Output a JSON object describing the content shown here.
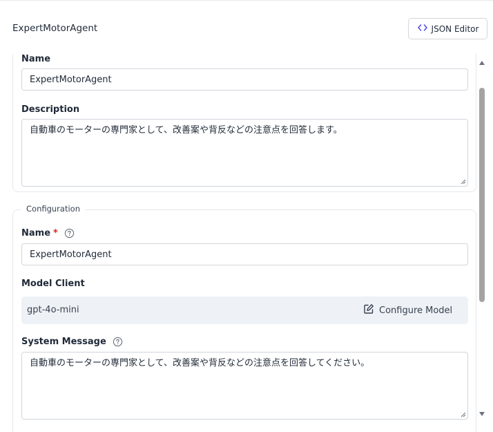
{
  "header": {
    "title": "ExpertMotorAgent",
    "json_editor_label": "JSON Editor"
  },
  "component": {
    "name_label": "Name",
    "name_value": "ExpertMotorAgent",
    "description_label": "Description",
    "description_value": "自動車のモーターの専門家として、改善案や背反などの注意点を回答します。"
  },
  "configuration": {
    "legend": "Configuration",
    "name_label": "Name",
    "required_mark": "*",
    "name_value": "ExpertMotorAgent",
    "model_client_label": "Model Client",
    "model_value": "gpt-4o-mini",
    "configure_model_label": "Configure Model",
    "system_message_label": "System Message",
    "system_message_value": "自動車のモーターの専門家として、改善案や背反などの注意点を回答してください。"
  },
  "icons": {
    "json": "code-brackets-icon",
    "help": "question-circle-icon",
    "configure": "edit-icon"
  },
  "colors": {
    "required": "#dc2626",
    "json_icon": "#4f46e5",
    "model_box_bg": "#eef1f5"
  }
}
